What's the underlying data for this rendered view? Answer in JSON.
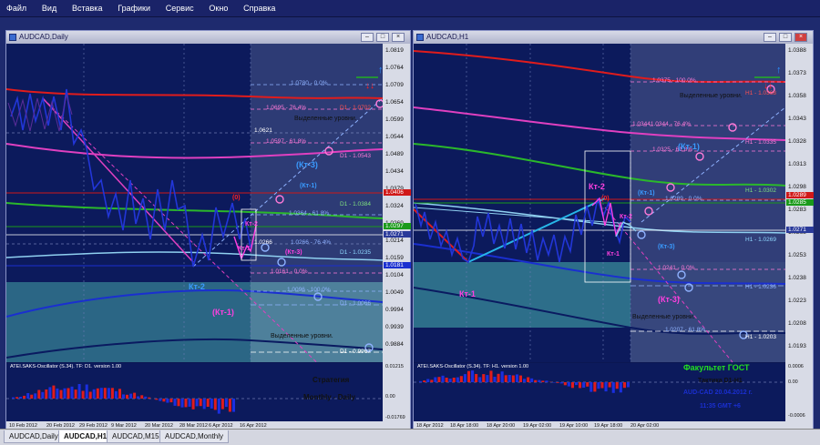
{
  "menu": [
    "Файл",
    "Вид",
    "Вставка",
    "Графики",
    "Сервис",
    "Окно",
    "Справка"
  ],
  "windows": {
    "left": {
      "title": "AUDCAD,Daily",
      "price_labels": [
        "1.0819",
        "1.0764",
        "1.0709",
        "1.0654",
        "1.0599",
        "1.0544",
        "1.0489",
        "1.0434",
        "1.0379",
        "1.0324",
        "1.0269",
        "1.0214",
        "1.0159",
        "1.0104",
        "1.0049",
        "0.9994",
        "0.9939",
        "0.9884"
      ],
      "price_tags": [
        {
          "text": "1.0406",
          "color": "#d01818"
        },
        {
          "text": "1.0297",
          "color": "#1a9a1a"
        },
        {
          "text": "1.0271",
          "color": "#2a3a9a"
        },
        {
          "text": "1.0181",
          "color": "#1a2fd0"
        }
      ],
      "date_labels": [
        "10 Feb 2012",
        "20 Feb 2012",
        "29 Feb 2012",
        "9 Mar 2012",
        "20 Mar 2012",
        "28 Mar 2012",
        "6 Apr 2012",
        "16 Apr 2012"
      ],
      "fib_labels": [
        {
          "text": "1.0780 - 0.0%",
          "color": "#8fb2ff"
        },
        {
          "text": "1.0695 - 76.4%",
          "color": "#ff7ad8"
        },
        {
          "text": "1.0621",
          "color": "#ffffff"
        },
        {
          "text": "1.0597 - 61.8%",
          "color": "#ff7ad8"
        },
        {
          "text": "1.0364 - 61.8%",
          "color": "#8fb2ff"
        },
        {
          "text": "1.0266",
          "color": "#ffffff"
        },
        {
          "text": "1.0266 - 76.4%",
          "color": "#8fb2ff"
        },
        {
          "text": "1.0161 - 0.0%",
          "color": "#ff7ad8"
        },
        {
          "text": "1.0096 - 100.0%",
          "color": "#8fb2ff"
        }
      ],
      "level_labels": [
        {
          "text": "D1 - 1.0702",
          "color": "#ff5050"
        },
        {
          "text": "D1 - 1.0543",
          "color": "#ff7ad8"
        },
        {
          "text": "D1 - 1.0384",
          "color": "#7fe07f"
        },
        {
          "text": "D1 - 1.0235",
          "color": "#8fd8ff"
        },
        {
          "text": "D1 - 1.0066",
          "color": "#8fb2ff"
        },
        {
          "text": "D1 - 0.9967",
          "color": "#ffffff"
        }
      ],
      "annotations": {
        "highlight_top": "Выделенные уровни.",
        "highlight_bottom": "Выделенные уровни.",
        "kt3": "(Кт-3)",
        "kt1": "(Кт-1)",
        "zero": "(0)",
        "kt2_small": "Кт-2",
        "kt1_small": "Кт-1",
        "kt3_small": "(Кт-3)",
        "kt2_big": "Кт-2",
        "kt1_big": "(Кт-1)"
      },
      "oscillator": {
        "label": "ATEI.SAKS-Oscillator (S.34). TF: D1. version 1.00",
        "scale": [
          "0.01215",
          "0.00",
          "-0.01769"
        ],
        "note_line1": "Стратегия",
        "note_line2": "Monthly - Daily"
      }
    },
    "right": {
      "title": "AUDCAD,H1",
      "price_labels": [
        "1.0388",
        "1.0373",
        "1.0358",
        "1.0343",
        "1.0328",
        "1.0313",
        "1.0298",
        "1.0283",
        "1.0268",
        "1.0253",
        "1.0238",
        "1.0223",
        "1.0208",
        "1.0193"
      ],
      "price_tags": [
        {
          "text": "1.0289",
          "color": "#d01818"
        },
        {
          "text": "1.0285",
          "color": "#1a9a1a"
        },
        {
          "text": "1.0271",
          "color": "#2a3a9a"
        }
      ],
      "date_labels": [
        "18 Apr 2012",
        "18 Apr 18:00",
        "18 Apr 20:00",
        "19 Apr 02:00",
        "19 Apr 10:00",
        "19 Apr 18:00",
        "20 Apr 02:00"
      ],
      "fib_labels": [
        {
          "text": "1.0375 - 100.0%",
          "color": "#ff7ad8"
        },
        {
          "text": "1.03441.0344 - 76.4%",
          "color": "#ff7ad8"
        },
        {
          "text": "1.0325 - 61.8%",
          "color": "#ff7ad8"
        },
        {
          "text": "1.0289 - 0.0%",
          "color": "#8fb2ff"
        },
        {
          "text": "1.0241 - 0.0%",
          "color": "#ff7ad8"
        },
        {
          "text": "1.0207 - 61.8%",
          "color": "#8fb2ff"
        }
      ],
      "level_labels": [
        {
          "text": "H1 - 1.0368",
          "color": "#ff5050"
        },
        {
          "text": "H1 - 1.0335",
          "color": "#ff7ad8"
        },
        {
          "text": "H1 - 1.0302",
          "color": "#7fe07f"
        },
        {
          "text": "H1 - 1.0269",
          "color": "#8fd8ff"
        },
        {
          "text": "H1 - 1.0236",
          "color": "#8fb2ff"
        },
        {
          "text": "H1 - 1.0203",
          "color": "#ffffff"
        }
      ],
      "annotations": {
        "highlight_top": "Выделенные уровни.",
        "highlight_bottom": "Выделенные уровни.",
        "kt1_top": "(Кт-1)",
        "kt2": "Кт-2",
        "zero": "(0)",
        "kt1_small": "(Кт-1)",
        "kt2_small": "Кт-2",
        "kt1_mid": "Кт-1",
        "kt3_small": "(Кт-3)",
        "kt3_big": "(Кт-3)",
        "kt1_big": "Кт-1"
      },
      "oscillator": {
        "label": "ATEI.SAKS-Oscillator (S.34). TF: H1. version 1.00",
        "scale": [
          "0.0006",
          "0.00",
          "-0.0006"
        ],
        "faculty": "Факультет ГОСТ",
        "tactic": "Тактика   D1-H1",
        "pair_date": "AUD-CAD  20.04.2012 г.",
        "time": "11:35  GMT +6"
      }
    }
  },
  "tabs": [
    {
      "label": "AUDCAD,Daily",
      "active": false
    },
    {
      "label": "AUDCAD,H1",
      "active": true
    },
    {
      "label": "AUDCAD,M15",
      "active": false
    },
    {
      "label": "AUDCAD,Monthly",
      "active": false
    }
  ]
}
